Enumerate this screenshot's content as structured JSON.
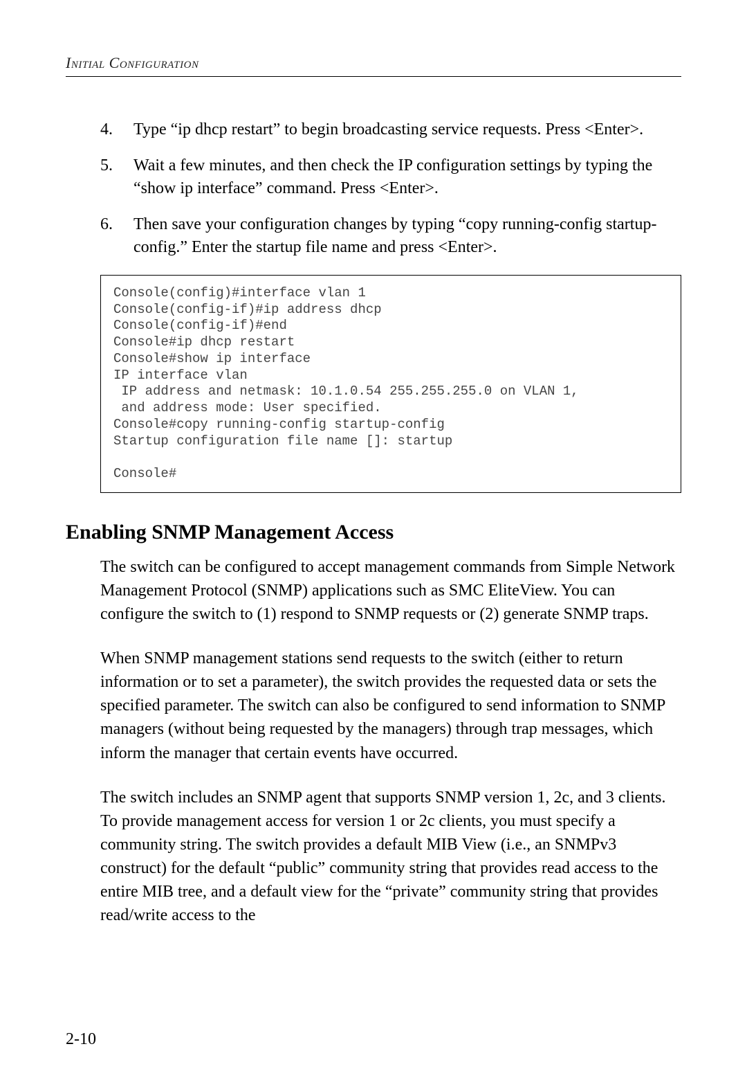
{
  "header": {
    "running_title": "Initial Configuration"
  },
  "steps": [
    {
      "number": "4.",
      "text": "Type “ip dhcp restart” to begin broadcasting service requests. Press <Enter>."
    },
    {
      "number": "5.",
      "text": "Wait a few minutes, and then check the IP configuration settings by typing the “show ip interface” command. Press <Enter>."
    },
    {
      "number": "6.",
      "text": "Then save your configuration changes by typing “copy running-config startup-config.” Enter the startup file name and press <Enter>."
    }
  ],
  "console": "Console(config)#interface vlan 1\nConsole(config-if)#ip address dhcp\nConsole(config-if)#end\nConsole#ip dhcp restart\nConsole#show ip interface\nIP interface vlan\n IP address and netmask: 10.1.0.54 255.255.255.0 on VLAN 1,\n and address mode: User specified.\nConsole#copy running-config startup-config\nStartup configuration file name []: startup\n\nConsole#",
  "section_heading": "Enabling SNMP Management Access",
  "paragraphs": [
    "The switch can be configured to accept management commands from Simple Network Management Protocol (SNMP) applications such as SMC EliteView. You can configure the switch to (1) respond to SNMP requests or (2) generate SNMP traps.",
    "When SNMP management stations send requests to the switch (either to return information or to set a parameter), the switch provides the requested data or sets the specified parameter. The switch can also be configured to send information to SNMP managers (without being requested by the managers) through trap messages, which inform the manager that certain events have occurred.",
    "The switch includes an SNMP agent that supports SNMP version 1, 2c, and 3 clients. To provide management access for version 1 or 2c clients, you must specify a community string. The switch provides a default MIB View (i.e., an SNMPv3 construct) for the default “public” community string that provides read access to the entire MIB tree, and a default view for the “private” community string that provides read/write access to the"
  ],
  "page_number": "2-10"
}
